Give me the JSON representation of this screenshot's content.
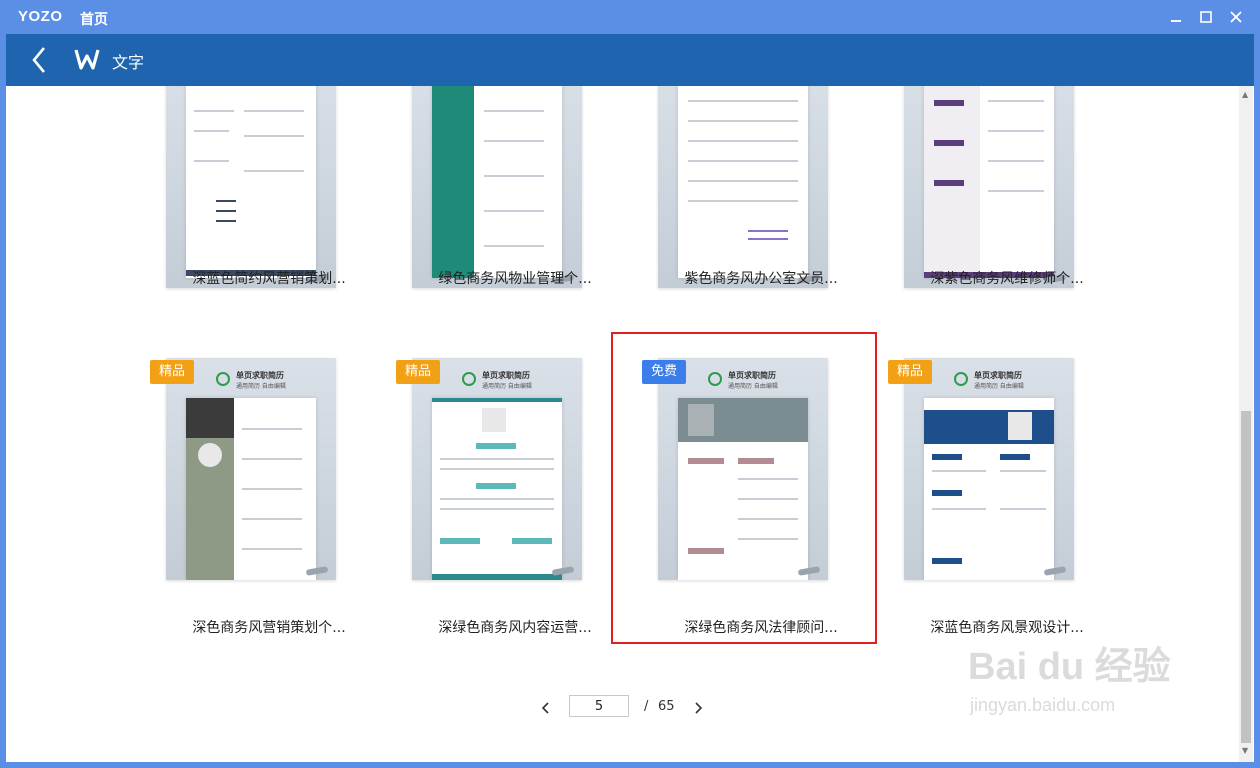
{
  "window": {
    "app_logo": "YOZO",
    "title": "首页"
  },
  "header": {
    "label": "文字"
  },
  "templates": [
    {
      "name": "深蓝色简约风营销策划...",
      "badge": ""
    },
    {
      "name": "绿色商务风物业管理个...",
      "badge": ""
    },
    {
      "name": "紫色商务风办公室文员...",
      "badge": ""
    },
    {
      "name": "深紫色商务风维修师个...",
      "badge": ""
    },
    {
      "name": "深色商务风营销策划个...",
      "badge": "精品"
    },
    {
      "name": "深绿色商务风内容运营...",
      "badge": "精品"
    },
    {
      "name": "深绿色商务风法律顾问...",
      "badge": "免费"
    },
    {
      "name": "深蓝色商务风景观设计...",
      "badge": "精品"
    }
  ],
  "thumbnail_branding": {
    "title": "单页求职简历",
    "subtitle": "通用简历 自由编辑"
  },
  "pagination": {
    "current_page": "5",
    "separator": "/",
    "total_pages": "65"
  },
  "watermark": {
    "main": "Bai du 经验",
    "sub": "jingyan.baidu.com"
  },
  "colors": {
    "titlebar": "#5b8fe6",
    "appbar": "#1e64ae",
    "badge_premium": "#f2a116",
    "badge_free": "#3b7ee9",
    "highlight": "#e02020"
  },
  "icons": {
    "back": "chevron-left-icon",
    "app": "w-logo-icon",
    "minimize": "minimize-icon",
    "maximize": "maximize-icon",
    "close": "close-icon"
  }
}
